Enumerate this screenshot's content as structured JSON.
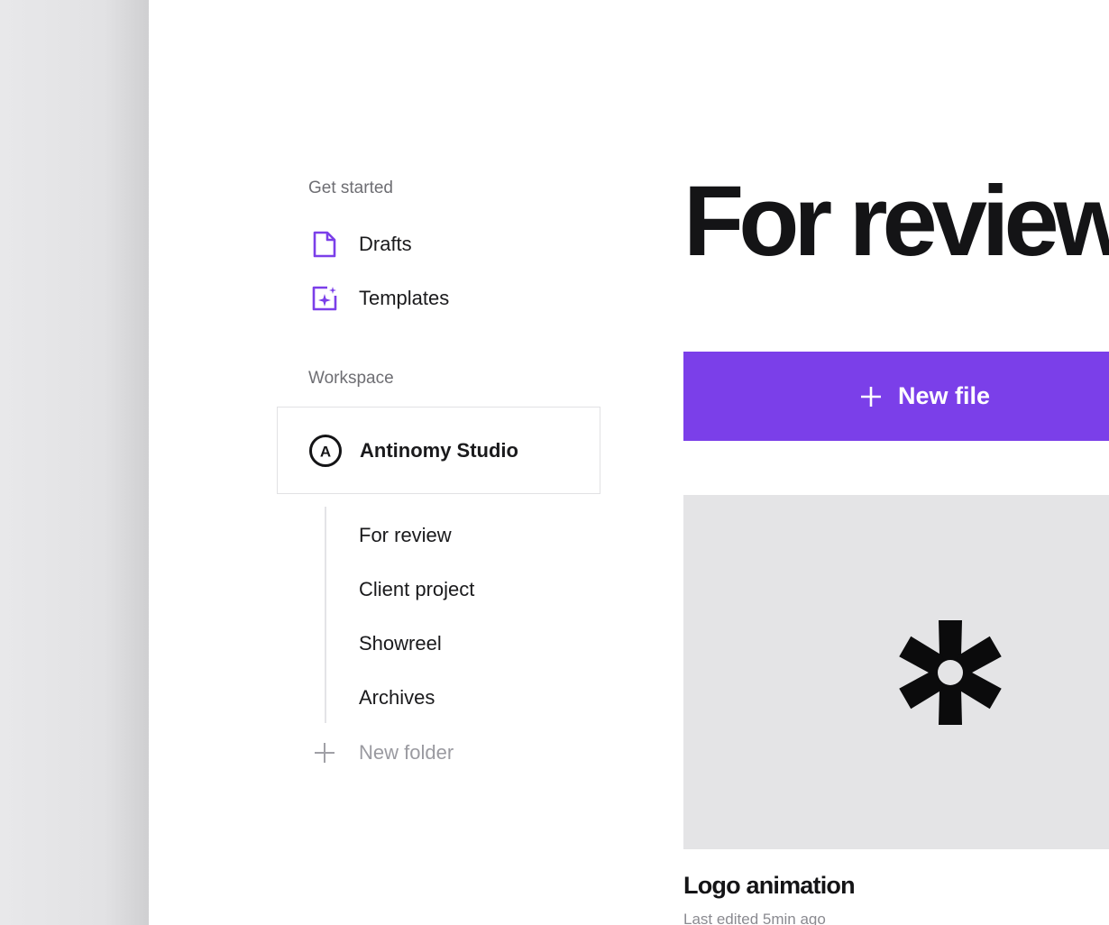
{
  "sidebar": {
    "get_started_label": "Get started",
    "get_started_items": [
      {
        "label": "Drafts",
        "icon": "file-icon"
      },
      {
        "label": "Templates",
        "icon": "sparkle-template-icon"
      }
    ],
    "workspace_label": "Workspace",
    "workspace": {
      "name": "Antinomy Studio",
      "icon": "workspace-avatar-icon",
      "avatar_letter": "A"
    },
    "folders": [
      {
        "label": "For review"
      },
      {
        "label": "Client project"
      },
      {
        "label": "Showreel"
      },
      {
        "label": "Archives"
      }
    ],
    "new_folder_label": "New folder"
  },
  "main": {
    "title": "For review",
    "new_file_label": "New file",
    "files": [
      {
        "title": "Logo animation",
        "meta": "Last edited 5min ago",
        "thumbnail_icon": "asterisk-logo-icon"
      }
    ]
  },
  "colors": {
    "accent": "#7b3fe9",
    "text_primary": "#141416",
    "text_muted": "#6e6e73",
    "thumbnail_bg": "#e4e4e6"
  }
}
